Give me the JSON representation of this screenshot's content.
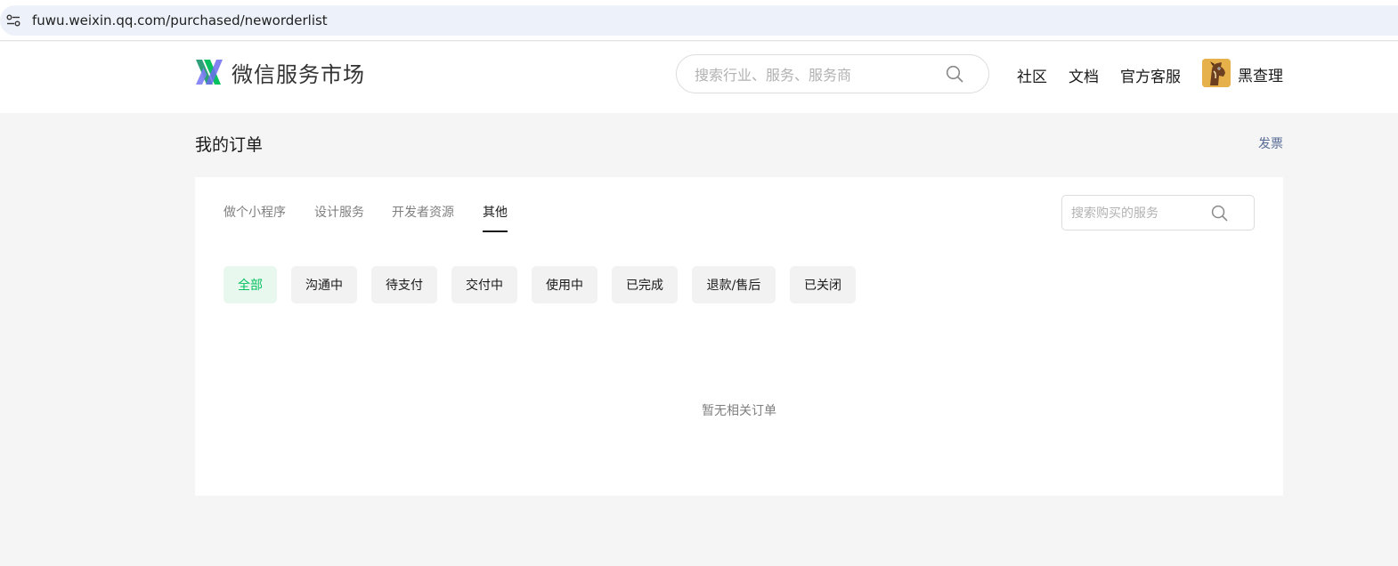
{
  "browser": {
    "url": "fuwu.weixin.qq.com/purchased/neworderlist"
  },
  "header": {
    "brand": "微信服务市场",
    "search": {
      "placeholder": "搜索行业、服务、服务商",
      "value": ""
    },
    "nav": [
      "社区",
      "文档",
      "官方客服"
    ],
    "user": {
      "name": "黑查理"
    }
  },
  "page": {
    "title": "我的订单",
    "invoice_label": "发票"
  },
  "orders": {
    "category_tabs": [
      {
        "label": "做个小程序",
        "active": false
      },
      {
        "label": "设计服务",
        "active": false
      },
      {
        "label": "开发者资源",
        "active": false
      },
      {
        "label": "其他",
        "active": true
      }
    ],
    "search": {
      "placeholder": "搜索购买的服务",
      "value": ""
    },
    "status_filters": [
      {
        "label": "全部",
        "active": true
      },
      {
        "label": "沟通中",
        "active": false
      },
      {
        "label": "待支付",
        "active": false
      },
      {
        "label": "交付中",
        "active": false
      },
      {
        "label": "使用中",
        "active": false
      },
      {
        "label": "已完成",
        "active": false
      },
      {
        "label": "退款/售后",
        "active": false
      },
      {
        "label": "已关闭",
        "active": false
      }
    ],
    "empty_text": "暂无相关订单"
  },
  "colors": {
    "brand_green": "#07c160",
    "link_blue": "#576b95",
    "page_bg": "#f5f5f5"
  },
  "icons": [
    "site-info-icon",
    "wechat-service-logo-icon",
    "search-icon",
    "avatar"
  ]
}
